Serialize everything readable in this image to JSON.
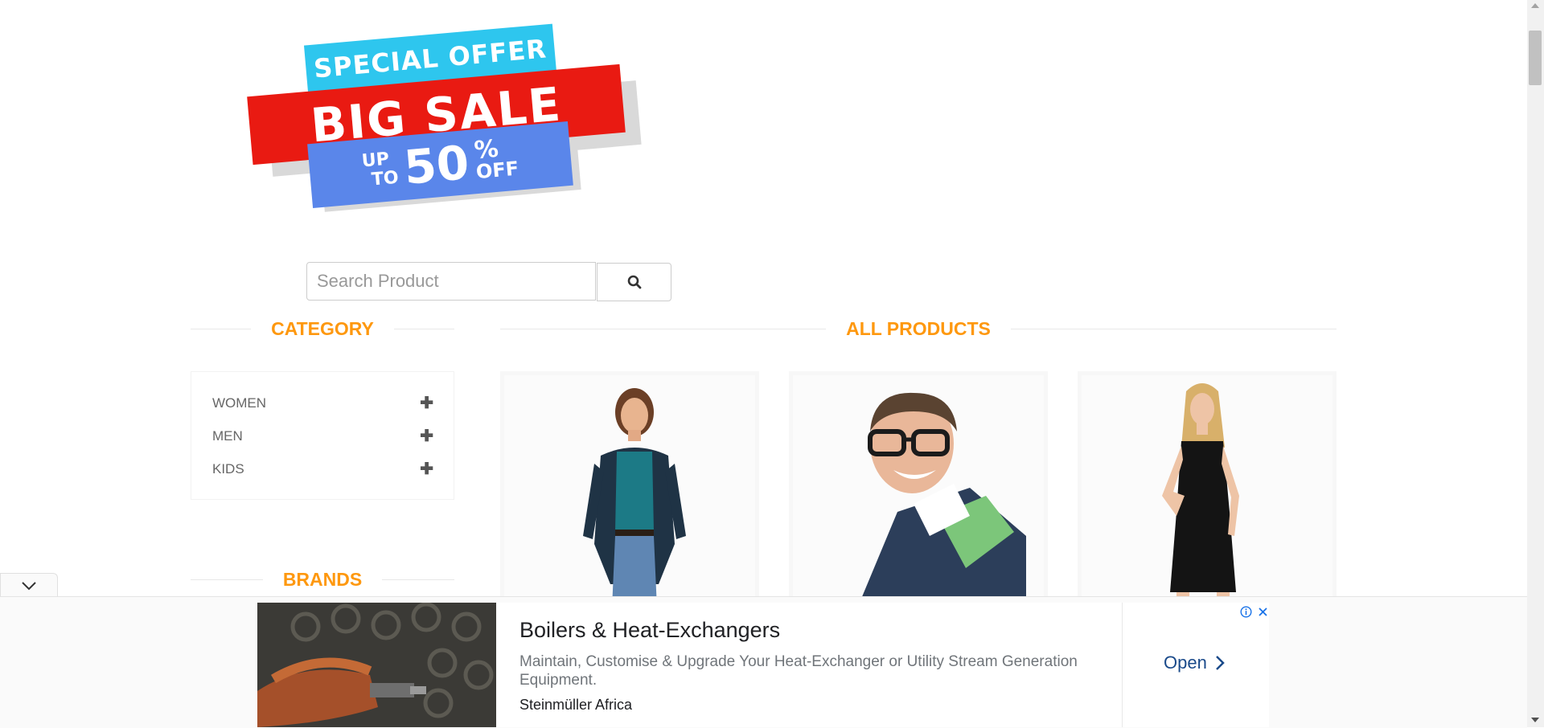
{
  "banner": {
    "line1": "SPECIAL OFFER",
    "line2": "BIG SALE",
    "up": "UP",
    "to": "TO",
    "amount": "50",
    "percent": "%",
    "off": "OFF"
  },
  "search": {
    "placeholder": "Search Product",
    "button_icon": "search-icon"
  },
  "sections": {
    "category_title": "CATEGORY",
    "products_title": "ALL PRODUCTS",
    "brands_title": "BRANDS"
  },
  "categories": [
    {
      "label": "WOMEN",
      "icon": "plus-icon"
    },
    {
      "label": "MEN",
      "icon": "plus-icon"
    },
    {
      "label": "KIDS",
      "icon": "plus-icon"
    }
  ],
  "products": [
    {
      "image": "woman-in-cardigan-photo"
    },
    {
      "image": "man-with-glasses-photo"
    },
    {
      "image": "woman-in-black-dress-photo"
    }
  ],
  "ad": {
    "headline": "Boilers & Heat-Exchangers",
    "description": "Maintain, Customise & Upgrade Your Heat-Exchanger or Utility Stream Generation Equipment.",
    "advertiser": "Steinmüller Africa",
    "cta": "Open",
    "info_icon": "info-icon",
    "close_icon": "close-icon",
    "collapse_icon": "chevron-down-icon"
  },
  "colors": {
    "accent": "#fe980f",
    "banner_cyan": "#2ec6ee",
    "banner_red": "#e91a12",
    "banner_blue": "#5a86ea",
    "ad_link": "#1a4a8a"
  }
}
